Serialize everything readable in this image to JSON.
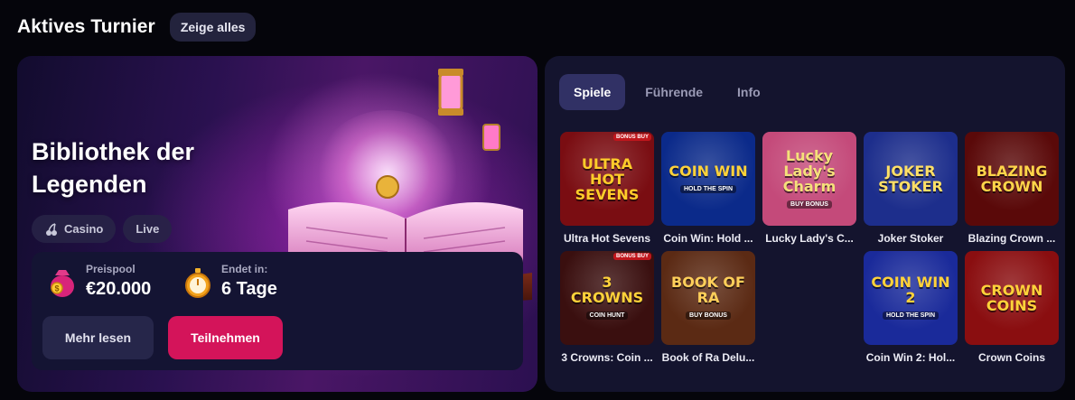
{
  "header": {
    "title": "Aktives Turnier",
    "show_all": "Zeige alles"
  },
  "tournament": {
    "title": "Bibliothek der Legenden",
    "tags": [
      {
        "label": "Casino",
        "icon": "cherry-icon"
      },
      {
        "label": "Live"
      }
    ],
    "prize_label": "Preispool",
    "prize_value": "€20.000",
    "ends_label": "Endet in:",
    "ends_value": "6 Tage",
    "more_button": "Mehr lesen",
    "join_button": "Teilnehmen"
  },
  "tabs": [
    {
      "label": "Spiele",
      "active": true
    },
    {
      "label": "Führende",
      "active": false
    },
    {
      "label": "Info",
      "active": false
    }
  ],
  "games": [
    {
      "name": "Ultra Hot Sevens",
      "logo": "ULTRA HOT SEVENS",
      "badge": "BONUS BUY",
      "bg": "#7a0d12",
      "fg": "#ffcc2a"
    },
    {
      "name": "Coin Win: Hold ...",
      "logo": "COIN WIN",
      "sub": "HOLD THE SPIN",
      "bg": "#0b2a8a",
      "fg": "#ffd23a"
    },
    {
      "name": "Lucky Lady's C...",
      "logo": "Lucky Lady's Charm",
      "sub": "BUY BONUS",
      "bg": "#c44a7a",
      "fg": "#f5e07a"
    },
    {
      "name": "Joker Stoker",
      "logo": "JOKER STOKER",
      "bg": "#1d2e8c",
      "fg": "#ffe066"
    },
    {
      "name": "Blazing Crown ...",
      "logo": "BLAZING CROWN",
      "bg": "#5a0909",
      "fg": "#ffd54a"
    },
    {
      "name": "3 Crowns: Coin ...",
      "logo": "3 CROWNS",
      "sub": "COIN HUNT",
      "badge": "BONUS BUY",
      "bg": "#3a0f0f",
      "fg": "#ffd23a"
    },
    {
      "name": "Book of Ra Delu...",
      "logo": "BOOK OF RA",
      "sub": "BUY BONUS",
      "bg": "#5b2a14",
      "fg": "#ffcf5a"
    },
    {
      "name": "Coin Win 2: Hol...",
      "logo": "COIN WIN 2",
      "sub": "HOLD THE SPIN",
      "bg": "#1a2a9a",
      "fg": "#ffd23a"
    },
    {
      "name": "Crown Coins",
      "logo": "CROWN COINS",
      "bg": "#8a0e10",
      "fg": "#ffd23a"
    }
  ]
}
